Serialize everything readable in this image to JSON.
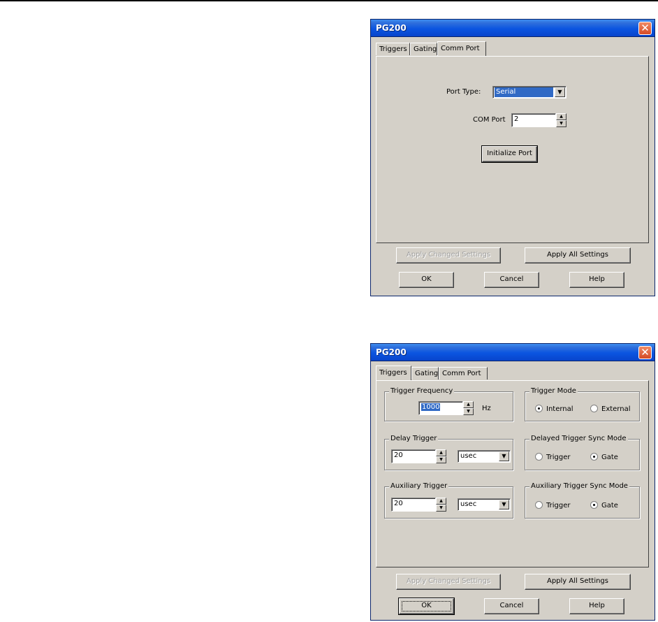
{
  "dialogs": [
    {
      "title": "PG200",
      "tabs": [
        "Triggers",
        "Gating",
        "Comm Port"
      ],
      "active_tab": "Comm Port",
      "comm_port": {
        "port_type_label": "Port Type:",
        "port_type_value": "Serial",
        "com_port_label": "COM Port",
        "com_port_value": "2",
        "initialize_label": "Initialize Port"
      },
      "buttons": {
        "apply_changed": "Apply Changed Settings",
        "apply_all": "Apply All Settings",
        "ok": "OK",
        "cancel": "Cancel",
        "help": "Help"
      }
    },
    {
      "title": "PG200",
      "tabs": [
        "Triggers",
        "Gating",
        "Comm Port"
      ],
      "active_tab": "Triggers",
      "triggers": {
        "frequency": {
          "group_label": "Trigger Frequency",
          "value": "1000",
          "unit": "Hz"
        },
        "mode": {
          "group_label": "Trigger Mode",
          "options": [
            "Internal",
            "External"
          ],
          "selected": "Internal"
        },
        "delay": {
          "group_label": "Delay Trigger",
          "value": "20",
          "unit": "usec"
        },
        "delay_sync": {
          "group_label": "Delayed Trigger Sync Mode",
          "options": [
            "Trigger",
            "Gate"
          ],
          "selected": "Gate"
        },
        "aux": {
          "group_label": "Auxiliary Trigger",
          "value": "20",
          "unit": "usec"
        },
        "aux_sync": {
          "group_label": "Auxiliary Trigger Sync Mode",
          "options": [
            "Trigger",
            "Gate"
          ],
          "selected": "Gate"
        }
      },
      "buttons": {
        "apply_changed": "Apply Changed Settings",
        "apply_all": "Apply All Settings",
        "ok": "OK",
        "cancel": "Cancel",
        "help": "Help"
      }
    }
  ],
  "icons": {
    "close": "close-icon",
    "dropdown": "chevron-down-icon",
    "spin_up": "arrow-up-icon",
    "spin_down": "arrow-down-icon"
  }
}
